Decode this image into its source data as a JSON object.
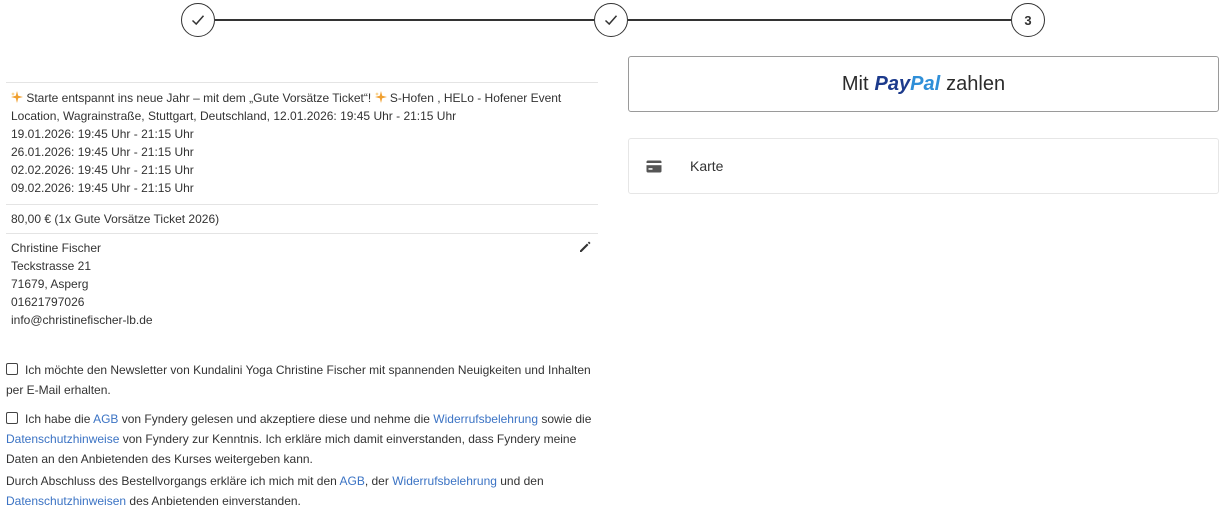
{
  "stepper": {
    "steps": [
      {
        "state": "done",
        "icon": "check-icon"
      },
      {
        "state": "done",
        "icon": "check-icon"
      },
      {
        "state": "current",
        "number": "3"
      }
    ]
  },
  "event": {
    "title_prefix_icon": "sparkles-icon",
    "title_part1": " Starte entspannt ins neue Jahr – mit dem „Gute Vorsätze Ticket“! ",
    "title_part2": " S-Hofen , HELo - Hofener Event Location, Wagrainstraße, Stuttgart, Deutschland, 12.01.2026: 19:45 Uhr - 21:15 Uhr",
    "dates": [
      "19.01.2026: 19:45 Uhr - 21:15 Uhr",
      "26.01.2026: 19:45 Uhr - 21:15 Uhr",
      "02.02.2026: 19:45 Uhr - 21:15 Uhr",
      "09.02.2026: 19:45 Uhr - 21:15 Uhr"
    ]
  },
  "price_summary": "80,00 € (1x Gute Vorsätze Ticket 2026)",
  "address": {
    "name": "Christine Fischer",
    "street": "Teckstrasse 21",
    "city": "71679, Asperg",
    "phone": "01621797026",
    "email": "info@christinefischer-lb.de",
    "edit_icon": "pencil-icon"
  },
  "newsletter": {
    "text": "Ich möchte den Newsletter von Kundalini Yoga Christine Fischer mit spannenden Neuigkeiten und Inhalten per E-Mail erhalten."
  },
  "terms": {
    "t1": "Ich habe die ",
    "agb": "AGB",
    "t2": " von Fyndery gelesen und akzeptiere diese und nehme die ",
    "widerruf": "Widerrufsbelehrung",
    "t3": " sowie die ",
    "datenschutz": "Datenschutzhinweise",
    "t4": " von Fyndery zur Kenntnis. Ich erkläre mich damit einverstanden, dass Fyndery meine Daten an den Anbietenden des Kurses weitergeben kann."
  },
  "closing": {
    "t1": "Durch Abschluss des Bestellvorgangs erkläre ich mich mit den ",
    "agb": "AGB",
    "t2": ", der ",
    "widerruf": "Widerrufsbelehrung",
    "t3": " und den ",
    "datenschutz": "Datenschutzhinweisen",
    "t4": " des Anbietenden einverstanden."
  },
  "payment": {
    "paypal_prefix": "Mit",
    "paypal_logo_pay": "Pay",
    "paypal_logo_pal": "Pal",
    "paypal_suffix": "zahlen",
    "card_label": "Karte",
    "card_icon": "credit-card-icon"
  },
  "colors": {
    "link": "#3b73c4",
    "paypal_dark": "#1c3a8c",
    "paypal_light": "#2f8fd8",
    "sparkle": "#f0a030"
  }
}
